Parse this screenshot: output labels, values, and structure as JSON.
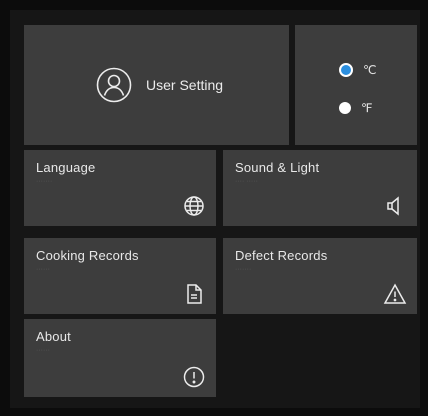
{
  "user_setting": {
    "label": "User Setting",
    "icon": "user-icon"
  },
  "temperature": {
    "options": [
      {
        "label": "℃",
        "selected": true
      },
      {
        "label": "℉",
        "selected": false
      }
    ],
    "accent": "#2b8fe0"
  },
  "tiles": {
    "language": {
      "title": "Language",
      "subtitle": "·······",
      "icon": "globe-icon"
    },
    "sound_light": {
      "title": "Sound & Light",
      "subtitle": "···· ·····",
      "icon": "speaker-icon"
    },
    "cooking_records": {
      "title": "Cooking Records",
      "subtitle": "······",
      "icon": "document-icon"
    },
    "defect_records": {
      "title": "Defect Records",
      "subtitle": "·······",
      "icon": "warning-icon"
    },
    "about": {
      "title": "About",
      "subtitle": "······",
      "icon": "info-icon"
    }
  }
}
